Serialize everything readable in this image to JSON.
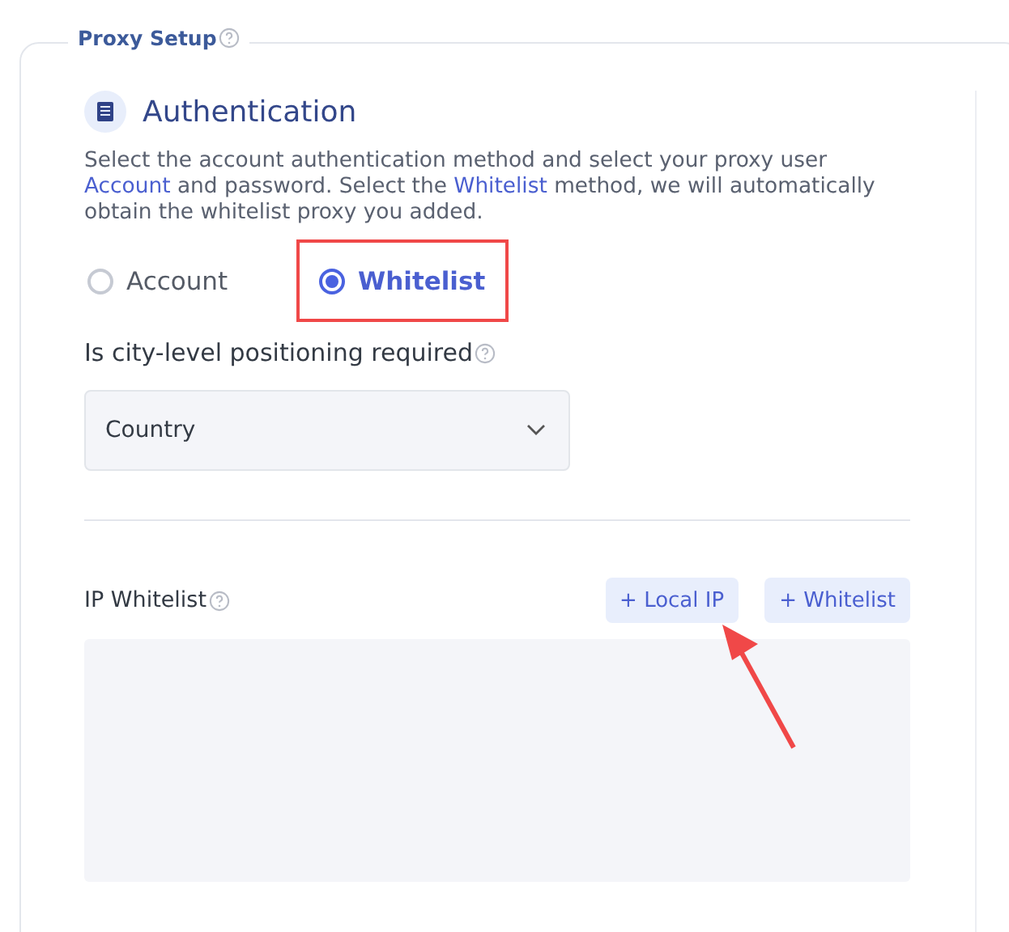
{
  "panel": {
    "legend": "Proxy Setup"
  },
  "section": {
    "title": "Authentication"
  },
  "description": [
    {
      "kind": "text",
      "text": "Select the account authentication method and select your proxy user "
    },
    {
      "kind": "link",
      "text": "Account"
    },
    {
      "kind": "text",
      "text": " and password. Select the "
    },
    {
      "kind": "link",
      "text": "Whitelist"
    },
    {
      "kind": "text",
      "text": " method, we will automatically obtain the whitelist proxy you added."
    }
  ],
  "auth_methods": [
    {
      "label": "Account",
      "selected": false,
      "highlighted": false
    },
    {
      "label": "Whitelist",
      "selected": true,
      "highlighted": true
    }
  ],
  "city_level": {
    "label": "Is city-level positioning required",
    "value": "Country"
  },
  "ip_whitelist": {
    "label": "IP Whitelist",
    "buttons": [
      {
        "label": "+ Local IP"
      },
      {
        "label": "+ Whitelist"
      }
    ]
  },
  "pointer_arrow": true
}
